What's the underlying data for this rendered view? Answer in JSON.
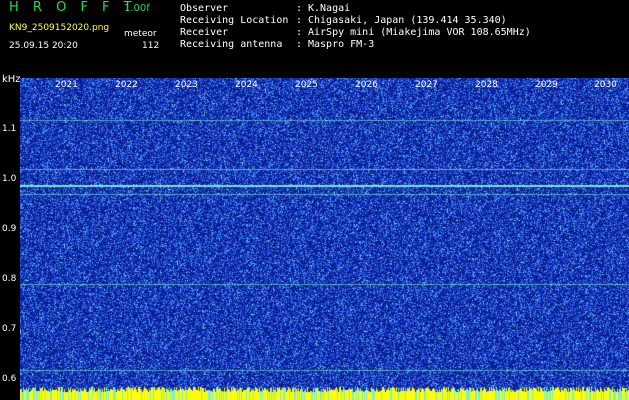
{
  "header": {
    "app_title": "H R O F F T",
    "version": "1.00f",
    "filename": "KN9_2509152020.png",
    "meteor_label": "meteor",
    "meteor_count": "112",
    "datetime": "25.09.15 20:20"
  },
  "info": [
    {
      "key": "Observer",
      "value": "K.Nagai"
    },
    {
      "key": "Receiving Location",
      "value": "Chigasaki, Japan (139.414 35.340)"
    },
    {
      "key": "Receiver",
      "value": "AirSpy mini (Miakejima VOR 108.65MHz)"
    },
    {
      "key": "Receiving antenna",
      "value": "Maspro FM-3"
    }
  ],
  "separator": ":",
  "spectrogram": {
    "y_unit": "kHz",
    "y_ticks": [
      "1.1",
      "1.0",
      "0.9",
      "0.8",
      "0.7",
      "0.6"
    ],
    "x_ticks": [
      "2021",
      "2022",
      "2023",
      "2024",
      "2025",
      "2026",
      "2027",
      "2028",
      "2029",
      "2030"
    ],
    "background_color": "#0a1e96",
    "noise_color": "#3c78ff",
    "line_color": "#7cf0c8",
    "bottom_bar_color": "#ffff00",
    "horizontal_lines_khz": [
      1.117,
      1.018,
      0.986,
      0.968,
      0.788,
      0.616
    ]
  }
}
